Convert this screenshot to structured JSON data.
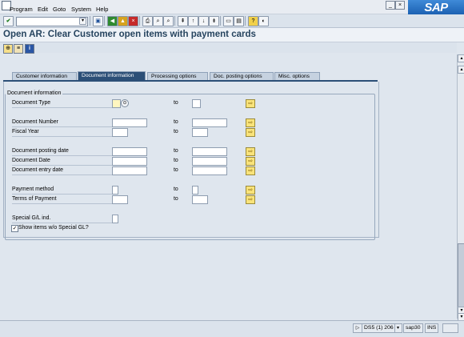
{
  "menu": [
    "Program",
    "Edit",
    "Goto",
    "System",
    "Help"
  ],
  "logo": "SAP",
  "title": "Open AR: Clear Customer open items with payment cards",
  "tabs": [
    "Customer information",
    "Document information",
    "Processing options",
    "Doc. posting options",
    "Misc. options"
  ],
  "active_tab": 1,
  "group_title": "Document information",
  "rows": [
    {
      "label": "Document Type",
      "to": "to"
    },
    {
      "label": "Document Number",
      "to": "to"
    },
    {
      "label": "Fiscal Year",
      "to": "to"
    },
    {
      "label": "Document posting date",
      "to": "to"
    },
    {
      "label": "Document Date",
      "to": "to"
    },
    {
      "label": "Document entry date",
      "to": "to"
    },
    {
      "label": "Payment method",
      "to": "to"
    },
    {
      "label": "Terms of Payment",
      "to": "to"
    },
    {
      "label": "Special G/L ind."
    }
  ],
  "checkbox": {
    "label": "Show items w/o Special GL?",
    "checked": true
  },
  "status": {
    "system": "DS5 (1) 206",
    "server": "sap30",
    "mode": "INS"
  },
  "colors": {
    "active_tab": "#2c4f77",
    "title": "#26445f",
    "required_field": "#fff6c0"
  }
}
